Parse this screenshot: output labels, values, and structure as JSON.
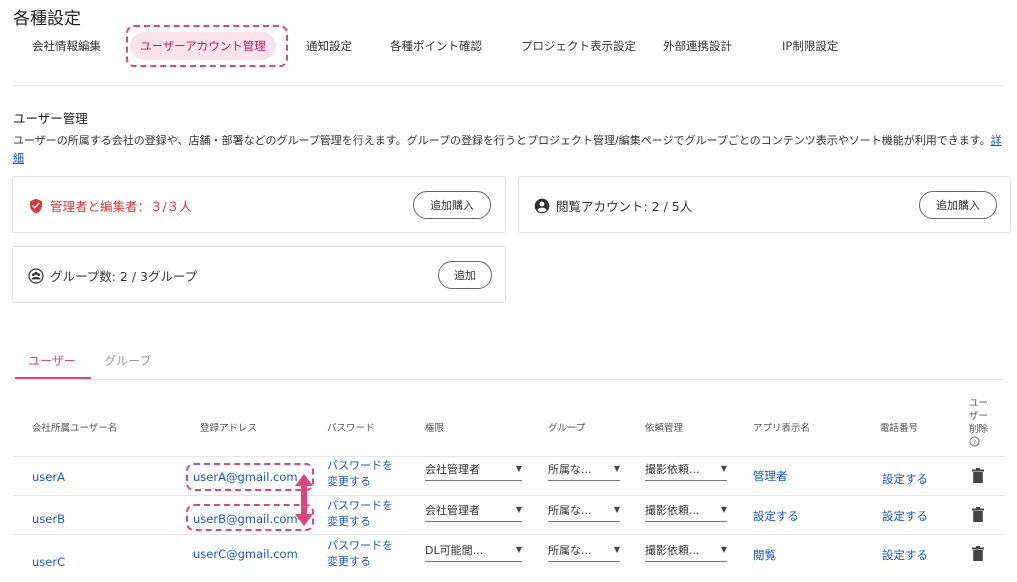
{
  "page": {
    "title": "各種設定"
  },
  "tabs": [
    {
      "label": "会社情報編集"
    },
    {
      "label": "ユーザーアカウント管理",
      "active": true
    },
    {
      "label": "通知設定"
    },
    {
      "label": "各種ポイント確認"
    },
    {
      "label": "プロジェクト表示設定"
    },
    {
      "label": "外部連携設計"
    },
    {
      "label": "IP制限設定"
    }
  ],
  "user_management": {
    "title": "ユーザー管理",
    "description": "ユーザーの所属する会社の登録や、店舗・部署などのグループ管理を行えます。グループの登録を行うとプロジェクト管理/編集ページでグループごとのコンテンツ表示やソート機能が利用できます。",
    "detail_link": "詳細"
  },
  "cards": {
    "admins": {
      "label": "管理者と編集者：３/３人",
      "button": "追加購入",
      "icon": "shield-check-icon"
    },
    "viewers": {
      "label": "閲覧アカウント: 2 / 5人",
      "button": "追加購入",
      "icon": "account-circle-icon"
    },
    "groups": {
      "label": "グループ数: 2 / 3グループ",
      "button": "追加",
      "icon": "group-circle-icon"
    }
  },
  "sub_tabs": [
    {
      "label": "ユーザー",
      "active": true
    },
    {
      "label": "グループ",
      "active": false
    }
  ],
  "table": {
    "headers": {
      "name": "会社所属ユーザー名",
      "email": "登録アドレス",
      "password": "パスワード",
      "role": "権限",
      "group": "グループ",
      "request": "依頼管理",
      "app_name": "アプリ表示名",
      "phone": "電話番号",
      "delete_1": "ユー",
      "delete_2": "ザー",
      "delete_3": "削除"
    },
    "rows": [
      {
        "name": "userA",
        "email": "userA@gmail.com",
        "pw1": "パスワードを",
        "pw2": "変更する",
        "role": "会社管理者",
        "group": "所属な...",
        "request": "撮影依頼...",
        "app_name": "管理者",
        "phone": "設定する"
      },
      {
        "name": "userB",
        "email": "userB@gmail.com",
        "pw1": "パスワードを",
        "pw2": "変更する",
        "role": "会社管理者",
        "group": "所属な...",
        "request": "撮影依頼...",
        "app_name": "設定する",
        "phone": "設定する"
      },
      {
        "name": "userC",
        "email": "userC@gmail.com",
        "pw1": "パスワードを",
        "pw2": "変更する",
        "role": "DL可能閲...",
        "group": "所属な...",
        "request": "撮影依頼...",
        "app_name": "閲覧",
        "phone": "設定する"
      }
    ]
  },
  "colors": {
    "accent": "#e04777",
    "link": "#1a56c4",
    "danger": "#d63a3a",
    "highlight": "#d9487a"
  }
}
